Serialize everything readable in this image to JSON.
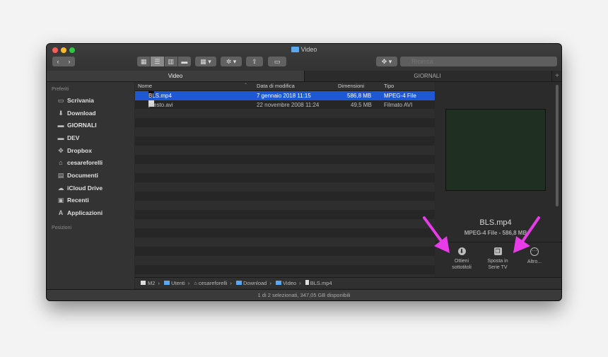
{
  "window": {
    "title": "Video"
  },
  "toolbar": {
    "back": "‹",
    "forward": "›",
    "search_placeholder": "Ricerca"
  },
  "tabs": [
    {
      "label": "Video"
    },
    {
      "label": "GIORNALI"
    }
  ],
  "sidebar": {
    "favorites_header": "Preferiti",
    "locations_header": "Posizioni",
    "items": [
      {
        "label": "Scrivania",
        "icon": "desktop-icon"
      },
      {
        "label": "Download",
        "icon": "download-icon"
      },
      {
        "label": "GIORNALI",
        "icon": "folder-icon"
      },
      {
        "label": "DEV",
        "icon": "folder-icon"
      },
      {
        "label": "Dropbox",
        "icon": "dropbox-icon"
      },
      {
        "label": "cesareforelli",
        "icon": "home-icon"
      },
      {
        "label": "Documenti",
        "icon": "document-icon"
      },
      {
        "label": "iCloud Drive",
        "icon": "cloud-icon"
      },
      {
        "label": "Recenti",
        "icon": "recents-icon"
      },
      {
        "label": "Applicazioni",
        "icon": "applications-icon"
      }
    ]
  },
  "columns": {
    "name": "Nome",
    "date": "Data di modifica",
    "size": "Dimensioni",
    "kind": "Tipo"
  },
  "files": [
    {
      "name": "BLS.mp4",
      "date": "7 gennaio 2018 11:15",
      "size": "586,8 MB",
      "kind": "MPEG-4 File",
      "selected": true
    },
    {
      "name": "presto.avi",
      "date": "22 novembre 2008 11:24",
      "size": "49,5 MB",
      "kind": "Filmato AVI",
      "selected": false
    }
  ],
  "preview": {
    "name": "BLS.mp4",
    "info": "MPEG-4 File - 586,8 MB",
    "actions": [
      {
        "label_1": "Ottieni",
        "label_2": "sottotitoli",
        "icon": "download-circle-icon"
      },
      {
        "label_1": "Sposta in",
        "label_2": "Serie TV",
        "icon": "move-icon"
      },
      {
        "label_1": "Altro...",
        "label_2": "",
        "icon": "more-icon"
      }
    ]
  },
  "path": [
    "M2",
    "Utenti",
    "cesareforelli",
    "Download",
    "Video",
    "BLS.mp4"
  ],
  "status": "1 di 2 selezionati, 347,05 GB disponibili",
  "colors": {
    "selection": "#1e58d5",
    "annotation_arrow": "#e83ce8",
    "folder": "#59a8f0"
  }
}
